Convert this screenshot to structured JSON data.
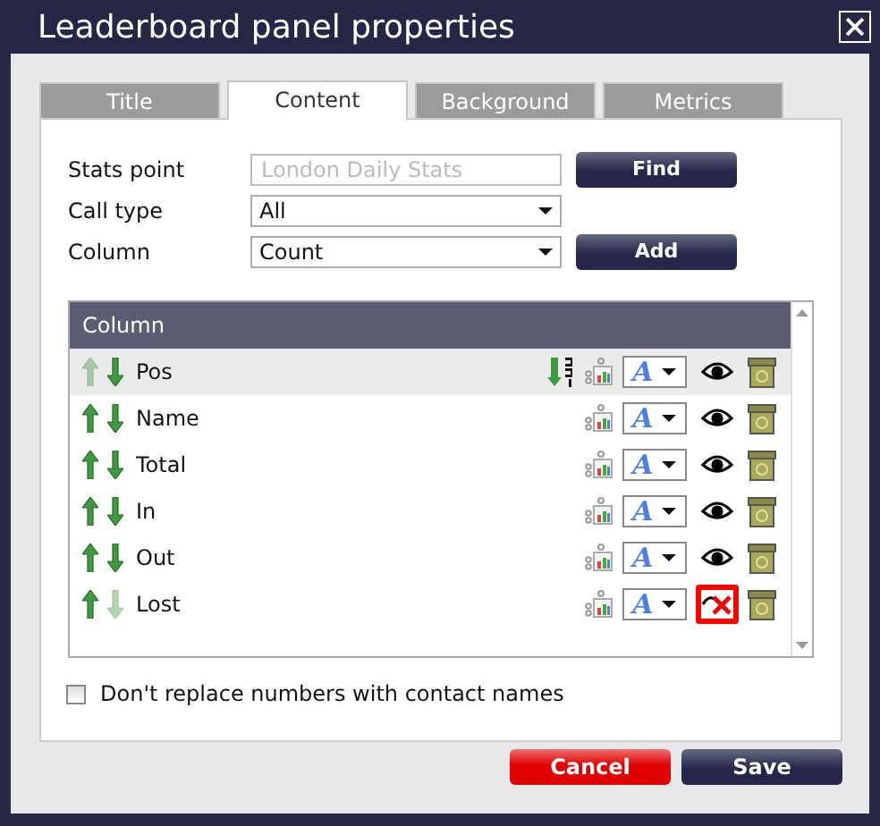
{
  "window": {
    "title": "Leaderboard panel properties"
  },
  "tabs": [
    {
      "label": "Title",
      "selected": false
    },
    {
      "label": "Content",
      "selected": true
    },
    {
      "label": "Background",
      "selected": false
    },
    {
      "label": "Metrics",
      "selected": false
    }
  ],
  "form": {
    "stats_point": {
      "label": "Stats point",
      "placeholder": "London Daily Stats"
    },
    "find_button": "Find",
    "call_type": {
      "label": "Call type",
      "value": "All"
    },
    "column": {
      "label": "Column",
      "value": "Count"
    },
    "add_button": "Add"
  },
  "table": {
    "header": "Column",
    "rows": [
      {
        "name": "Pos",
        "style_glyph": "A",
        "selected": true,
        "up_enabled": false,
        "down_enabled": true,
        "sorted": true,
        "visible": true,
        "highlighted": false
      },
      {
        "name": "Name",
        "style_glyph": "A",
        "selected": false,
        "up_enabled": true,
        "down_enabled": true,
        "sorted": false,
        "visible": true,
        "highlighted": false
      },
      {
        "name": "Total",
        "style_glyph": "A",
        "selected": false,
        "up_enabled": true,
        "down_enabled": true,
        "sorted": false,
        "visible": true,
        "highlighted": false
      },
      {
        "name": "In",
        "style_glyph": "A",
        "selected": false,
        "up_enabled": true,
        "down_enabled": true,
        "sorted": false,
        "visible": true,
        "highlighted": false
      },
      {
        "name": "Out",
        "style_glyph": "A",
        "selected": false,
        "up_enabled": true,
        "down_enabled": true,
        "sorted": false,
        "visible": true,
        "highlighted": false
      },
      {
        "name": "Lost",
        "style_glyph": "A",
        "selected": false,
        "up_enabled": true,
        "down_enabled": false,
        "sorted": false,
        "visible": false,
        "highlighted": true
      }
    ]
  },
  "option": {
    "label": "Don't replace numbers with contact names",
    "checked": false
  },
  "buttons": [
    {
      "label": "Cancel",
      "kind": "danger"
    },
    {
      "label": "Save",
      "kind": "primary"
    }
  ]
}
